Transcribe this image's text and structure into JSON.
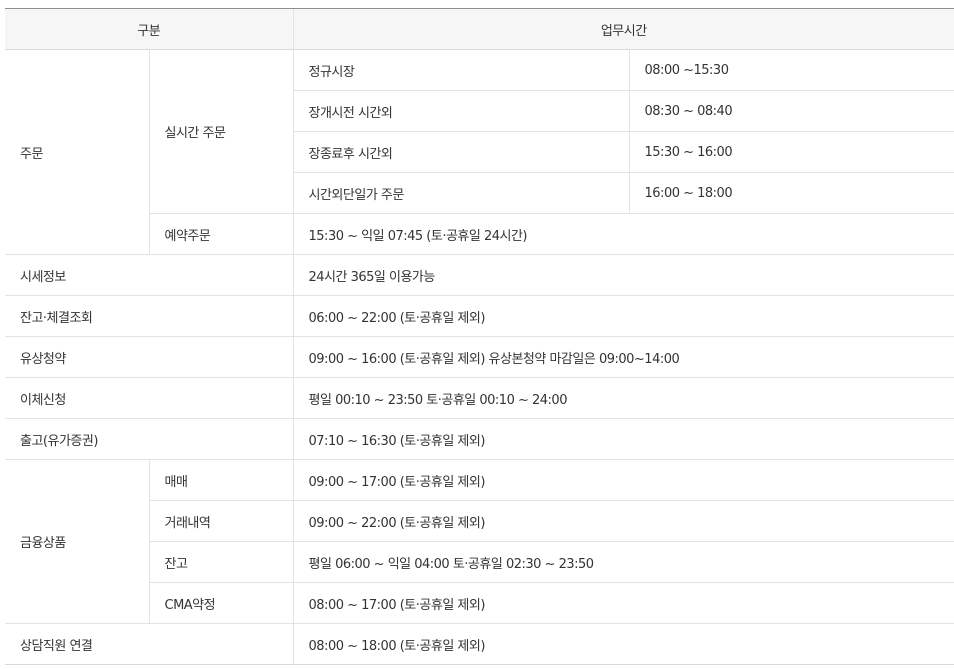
{
  "header": {
    "category": "구분",
    "hours": "업무시간"
  },
  "order": {
    "label": "주문",
    "realtime": {
      "label": "실시간 주문",
      "sessions": [
        {
          "name": "정규시장",
          "time": "08:00 ~15:30"
        },
        {
          "name": "장개시전 시간외",
          "time": "08:30 ~ 08:40"
        },
        {
          "name": "장종료후 시간외",
          "time": "15:30 ~ 16:00"
        },
        {
          "name": "시간외단일가 주문",
          "time": "16:00 ~ 18:00"
        }
      ]
    },
    "reserve": {
      "label": "예약주문",
      "time": "15:30 ~ 익일 07:45 (토·공휴일 24시간)"
    }
  },
  "quote": {
    "label": "시세정보",
    "time": "24시간 365일 이용가능"
  },
  "balance_inquiry": {
    "label": "잔고·체결조회",
    "time": "06:00 ~ 22:00 (토·공휴일 제외)"
  },
  "rights_offering": {
    "label": "유상청약",
    "time": "09:00 ~ 16:00 (토·공휴일 제외) 유상본청약 마감일은 09:00~14:00"
  },
  "transfer": {
    "label": "이체신청",
    "time": "평일 00:10 ~ 23:50 토·공휴일 00:10 ~ 24:00"
  },
  "withdrawal": {
    "label": "출고(유가증권)",
    "time": "07:10 ~ 16:30 (토·공휴일 제외)"
  },
  "financial": {
    "label": "금융상품",
    "items": [
      {
        "name": "매매",
        "time": "09:00 ~ 17:00 (토·공휴일 제외)"
      },
      {
        "name": "거래내역",
        "time": "09:00 ~ 22:00 (토·공휴일 제외)"
      },
      {
        "name": "잔고",
        "time": "평일 06:00 ~ 익일 04:00 토·공휴일 02:30 ~ 23:50"
      },
      {
        "name": "CMA약정",
        "time": "08:00 ~ 17:00 (토·공휴일 제외)"
      }
    ]
  },
  "consult": {
    "label": "상담직원 연결",
    "time": "08:00 ~ 18:00 (토·공휴일 제외)"
  }
}
